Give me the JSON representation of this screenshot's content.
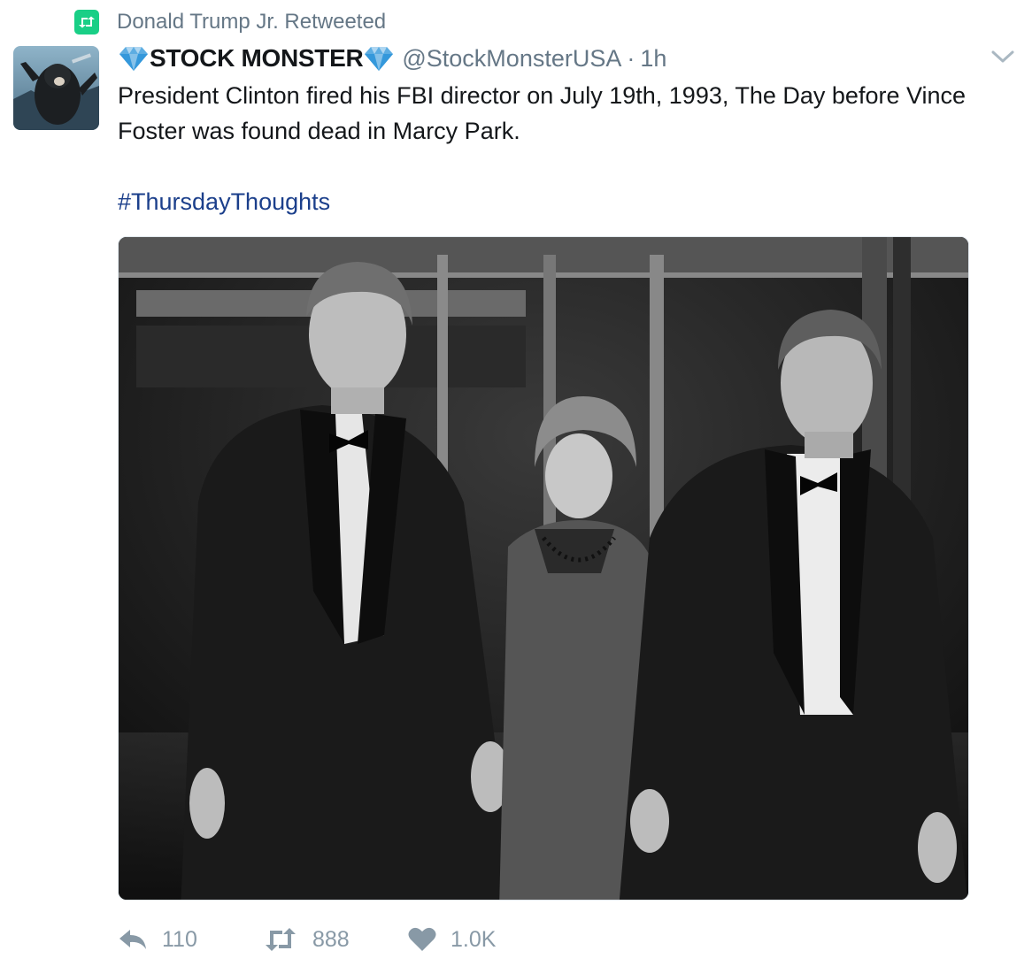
{
  "retweet_context": {
    "icon": "retweet-icon",
    "text": "Donald Trump Jr. Retweeted",
    "accent": "#19cf86"
  },
  "tweet": {
    "avatar_icon": "avatar-gorilla",
    "display_name": "STOCK MONSTER",
    "name_emoji": "gem-stone",
    "handle": "@StockMonsterUSA",
    "separator": "·",
    "time": "1h",
    "text": "President Clinton fired his FBI director on July 19th, 1993, The Day before Vince Foster was found dead in Marcy Park.",
    "hashtag": "#ThursdayThoughts",
    "hashtag_color": "#1b3f8b",
    "media": {
      "type": "photo",
      "description_icon": "black-and-white-photo"
    }
  },
  "actions": {
    "reply": {
      "icon": "reply-icon",
      "count": "110"
    },
    "retweet": {
      "icon": "retweet-icon",
      "count": "888"
    },
    "like": {
      "icon": "heart-icon",
      "count": "1.0K"
    },
    "color": "#8899a6"
  }
}
